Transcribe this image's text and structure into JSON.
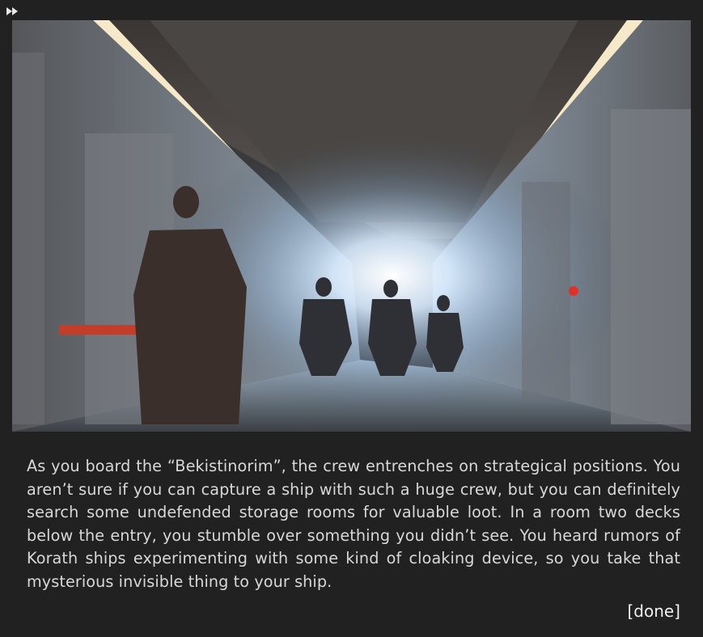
{
  "toolbar": {
    "fast_forward_icon": "fast-forward-icon"
  },
  "scene": {
    "description_icon": "spaceship-corridor-illustration"
  },
  "story": {
    "text": "As you board the “Bekistinorim”, the crew entrenches on strategical positions. You aren’t sure if you can capture a ship with such a huge crew, but you can definitely search some undefended storage rooms for valuable loot. In a room two decks below the entry, you stumble over something you didn’t see. You heard rumors of Korath ships experimenting with some kind of cloaking device, so you take that mysterious invisible thing to your ship."
  },
  "actions": {
    "done_label": "[done]"
  },
  "colors": {
    "background": "#212121",
    "text": "#d8d8d8",
    "link": "#f0f0f0"
  }
}
